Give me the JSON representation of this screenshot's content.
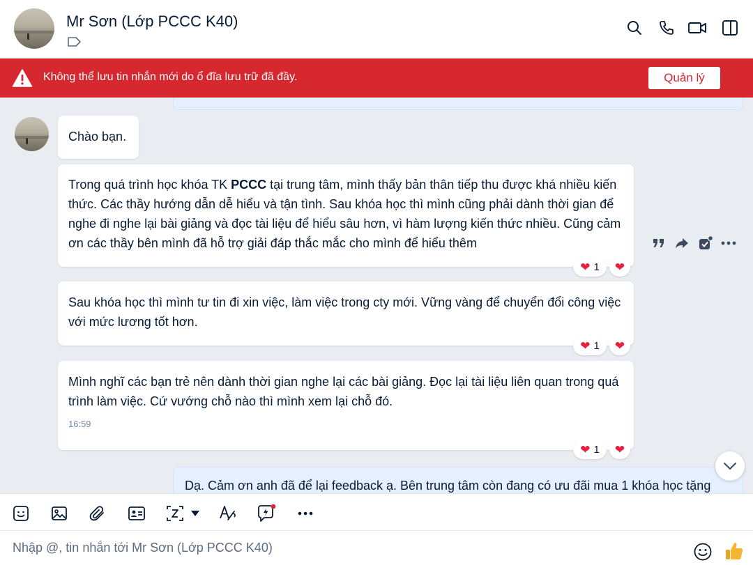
{
  "header": {
    "contact_name": "Mr Sơn (Lớp PCCC K40)"
  },
  "alert": {
    "message": "Không thể lưu tin nhắn mới do ổ đĩa lưu trữ đã đầy.",
    "button_label": "Quản lý",
    "color": "#d7282f"
  },
  "messages": [
    {
      "text": "Chào bạn."
    },
    {
      "text_before": "Trong quá trình học khóa TK ",
      "text_bold": "PCCC",
      "text_after": " tại trung tâm, mình thấy bản thân tiếp thu được khá nhiều kiến thức. Các thầy hướng dẫn dễ hiểu và tận tình. Sau khóa học thì mình cũng phải dành thời gian để nghe đi nghe lại bài giảng và đọc tài liệu để hiểu sâu hơn, vì hàm lượng kiến thức nhiều. Cũng cảm ơn các thầy bên mình đã hỗ trợ giải đáp thắc mắc cho mình để hiểu thêm",
      "reaction_count": "1"
    },
    {
      "text": "Sau khóa học thì mình tư tin đi xin việc, làm việc trong cty mới. Vững vàng để chuyển đổi công việc với mức lương tốt hơn.",
      "reaction_count": "1"
    },
    {
      "text": "Mình nghĩ các bạn trẻ nên dành thời gian nghe lại các bài giảng. Đọc lại tài liệu liên quan trong quá trình làm việc. Cứ vướng chỗ nào thì mình xem lại chỗ đó.",
      "time": "16:59",
      "reaction_count": "1"
    }
  ],
  "outgoing_preview": "Dạ. Cảm ơn anh đã để lại feedback ạ. Bên trung tâm còn đang có ưu đãi mua 1 khóa học tặng",
  "composer": {
    "placeholder": "Nhập @, tin nhắn tới Mr Sơn (Lớp PCCC K40)"
  },
  "icons": {
    "header": [
      "search-icon",
      "phone-icon",
      "video-call-icon",
      "sidebar-toggle-icon",
      "tag-icon"
    ],
    "hover_actions": [
      "quote-icon",
      "forward-icon",
      "task-check-icon",
      "more-icon"
    ],
    "toolbar": [
      "sticker-icon",
      "image-icon",
      "attach-icon",
      "contact-card-icon",
      "screenshot-icon",
      "dropdown-icon",
      "format-text-icon",
      "quick-message-icon",
      "more-icon"
    ],
    "composer": [
      "emoji-icon",
      "thumbs-up-icon"
    ],
    "reaction": "heart-icon"
  },
  "colors": {
    "accent_blue": "#0068ff",
    "outgoing_bubble": "#e5efff",
    "heart": "#e5213d"
  }
}
